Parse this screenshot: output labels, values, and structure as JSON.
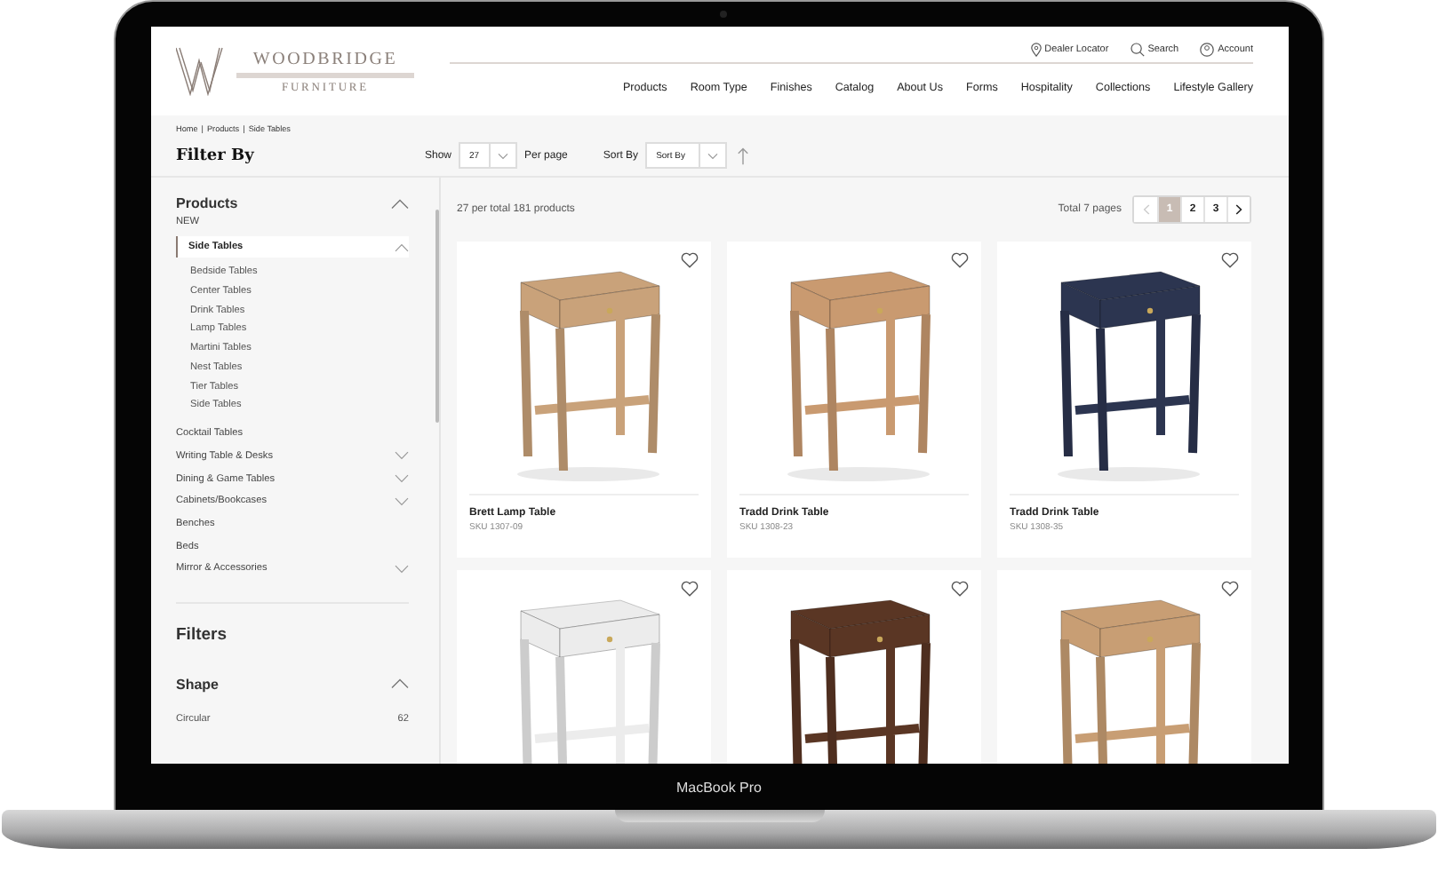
{
  "device": {
    "label": "MacBook Pro"
  },
  "header": {
    "logo": {
      "name": "WOODBRIDGE",
      "tagline": "FURNITURE"
    },
    "utility_links": [
      {
        "kind": "pin",
        "label": "Dealer Locator"
      },
      {
        "kind": "search",
        "label": "Search"
      },
      {
        "kind": "account",
        "label": "Account"
      }
    ],
    "nav": [
      "Products",
      "Room Type",
      "Finishes",
      "Catalog",
      "About Us",
      "Forms",
      "Hospitality",
      "Collections",
      "Lifestyle Gallery"
    ]
  },
  "breadcrumb": {
    "items": [
      "Home",
      "Products",
      "Side Tables"
    ],
    "separator": "|"
  },
  "toolbar": {
    "show_label": "Show",
    "per_page_value": "27",
    "per_page_label": "Per page",
    "sort_label": "Sort By",
    "sort_value": "Sort By"
  },
  "sidebar": {
    "title": "Filter By",
    "products": {
      "heading": "Products",
      "expanded": true,
      "items": [
        {
          "label": "NEW",
          "kind": "link",
          "selected": false
        },
        {
          "label": "Side Tables",
          "kind": "group",
          "selected": true,
          "expanded": true,
          "children": [
            {
              "label": "Bedside Tables"
            },
            {
              "label": "Center Tables"
            },
            {
              "label": "Drink Tables"
            },
            {
              "label": "Lamp Tables"
            },
            {
              "label": "Martini Tables"
            },
            {
              "label": "Nest Tables"
            },
            {
              "label": "Tier Tables"
            },
            {
              "label": "Side Tables"
            }
          ]
        },
        {
          "label": "Cocktail Tables",
          "kind": "link",
          "selected": false
        },
        {
          "label": "Writing Table & Desks",
          "kind": "group",
          "selected": false,
          "expanded": false
        },
        {
          "label": "Dining & Game Tables",
          "kind": "group",
          "selected": false,
          "expanded": false
        },
        {
          "label": "Cabinets/Bookcases",
          "kind": "group",
          "selected": false,
          "expanded": false
        },
        {
          "label": "Benches",
          "kind": "link",
          "selected": false
        },
        {
          "label": "Beds",
          "kind": "link",
          "selected": false
        },
        {
          "label": "Mirror & Accessories",
          "kind": "group",
          "selected": false,
          "expanded": false
        }
      ]
    },
    "filters": {
      "heading": "Filters",
      "sections": [
        {
          "heading": "Shape",
          "expanded": true,
          "options": [
            {
              "label": "Circular",
              "count": "62"
            }
          ]
        }
      ]
    }
  },
  "results": {
    "summary": "27 per total 181 products",
    "pages_label": "Total 7 pages",
    "pagination": {
      "prev_disabled": true,
      "next_disabled": false,
      "pages": [
        {
          "label": "1",
          "selected": true
        },
        {
          "label": "2",
          "selected": false
        },
        {
          "label": "3",
          "selected": false
        }
      ]
    }
  },
  "products": [
    {
      "name": "Brett Lamp Table",
      "sku": "SKU 1307-09",
      "color": "#c9a27a"
    },
    {
      "name": "Tradd Drink Table",
      "sku": "SKU 1308-23",
      "color": "#c99a70"
    },
    {
      "name": "Tradd Drink Table",
      "sku": "SKU 1308-35",
      "color": "#2c3550"
    },
    {
      "color": "#ececec"
    },
    {
      "color": "#5a3624"
    },
    {
      "color": "#c89e74"
    }
  ]
}
